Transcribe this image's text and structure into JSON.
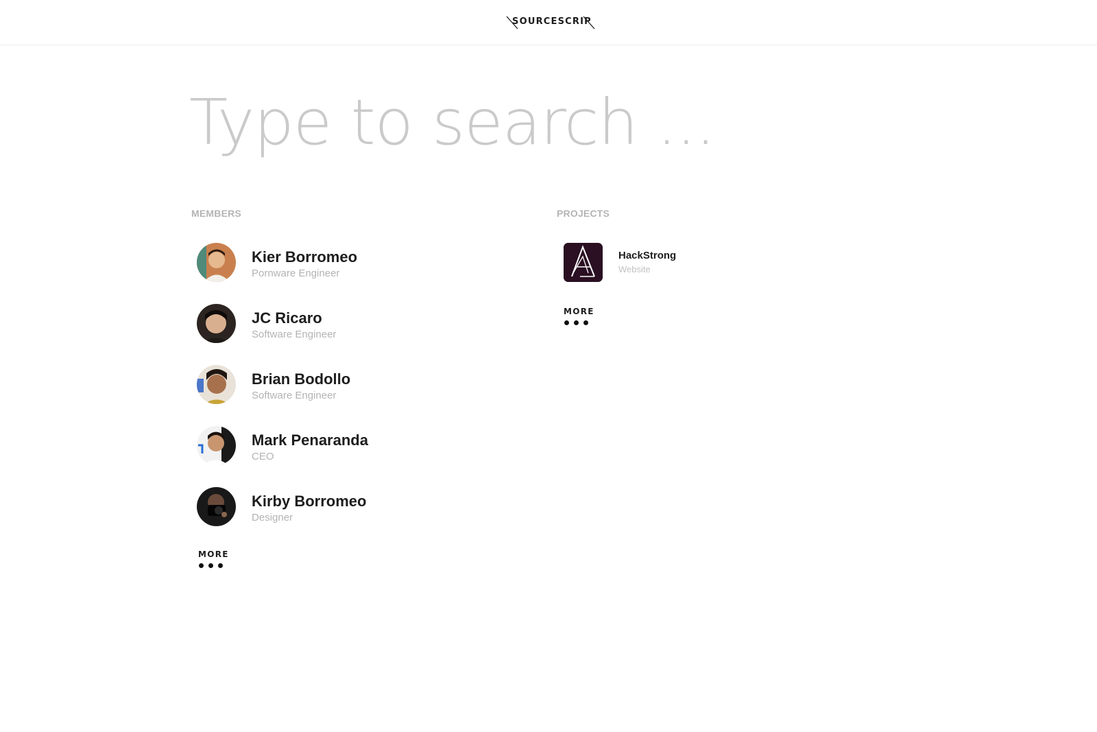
{
  "header": {
    "brand": "SOURCESCRIPT"
  },
  "search": {
    "placeholder": "Type to search ..."
  },
  "members": {
    "title": "MEMBERS",
    "items": [
      {
        "name": "Kier Borromeo",
        "role": "Pornware Engineer",
        "avatar_color": "#b86a3c"
      },
      {
        "name": "JC Ricaro",
        "role": "Software Engineer",
        "avatar_color": "#2b2420"
      },
      {
        "name": "Brian Bodollo",
        "role": "Software Engineer",
        "avatar_color": "#3c2e24"
      },
      {
        "name": "Mark Penaranda",
        "role": "CEO",
        "avatar_color": "#1a1a1a"
      },
      {
        "name": "Kirby Borromeo",
        "role": "Designer",
        "avatar_color": "#191919"
      }
    ],
    "more_label": "MORE"
  },
  "projects": {
    "title": "PROJECTS",
    "items": [
      {
        "name": "HackStrong",
        "type": "Website",
        "logo_color": "#2a1022"
      }
    ],
    "more_label": "MORE"
  }
}
